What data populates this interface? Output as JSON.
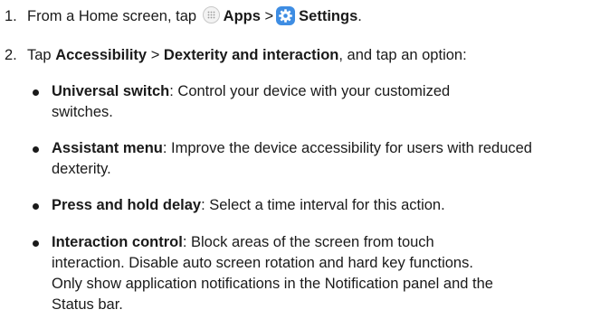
{
  "steps": [
    {
      "num": "1.",
      "prefix": "From a Home screen, tap",
      "apps_label": "Apps",
      "separator": ">",
      "settings_label": "Settings",
      "suffix": "."
    },
    {
      "num": "2.",
      "prefix": "Tap",
      "accessibility_label": "Accessibility",
      "separator": ">",
      "dexterity_label": "Dexterity and interaction",
      "suffix": ", and tap an option:"
    }
  ],
  "options": [
    {
      "term": "Universal switch",
      "desc": ": Control your device with your customized switches."
    },
    {
      "term": "Assistant menu",
      "desc": ": Improve the device accessibility for users with reduced dexterity."
    },
    {
      "term": "Press and hold delay",
      "desc": ": Select a time interval for this action."
    },
    {
      "term": "Interaction control",
      "desc": ": Block areas of the screen from touch interaction. Disable auto screen rotation and hard key functions. Only show application notifications in the Notification panel and the Status bar."
    }
  ],
  "icons": {
    "apps": "apps-grid-icon",
    "settings": "settings-gear-icon"
  },
  "colors": {
    "settings_icon_bg": "#3e8de3",
    "text": "#1a1a1a"
  }
}
